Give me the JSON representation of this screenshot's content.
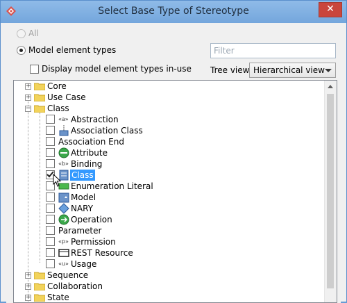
{
  "window": {
    "title": "Select Base Type of Stereotype",
    "close_glyph": "✕"
  },
  "options": {
    "all_label": "All",
    "model_types_label": "Model element types",
    "display_inuse_label": "Display model element types in-use",
    "filter_placeholder": "Filter",
    "tree_view_label": "Tree view:",
    "tree_view_value": "Hierarchical view"
  },
  "tree": {
    "core": "Core",
    "use_case": "Use Case",
    "class": "Class",
    "sequence": "Sequence",
    "collaboration": "Collaboration",
    "state": "State",
    "class_items": {
      "abstraction": "Abstraction",
      "association_class": "Association Class",
      "association_end": "Association End",
      "attribute": "Attribute",
      "binding": "Binding",
      "class": "Class",
      "enumeration_literal": "Enumeration Literal",
      "model": "Model",
      "nary": "NARY",
      "operation": "Operation",
      "parameter": "Parameter",
      "permission": "Permission",
      "rest_resource": "REST Resource",
      "usage": "Usage"
    },
    "stereo_marks": {
      "abstraction": "«a»",
      "binding": "«b»",
      "permission": "«p»",
      "usage": "«u»"
    }
  },
  "colors": {
    "selection": "#3399ff",
    "titlebar": "#7fb0e0",
    "close": "#c9463d",
    "folder": "#f2d35b"
  }
}
